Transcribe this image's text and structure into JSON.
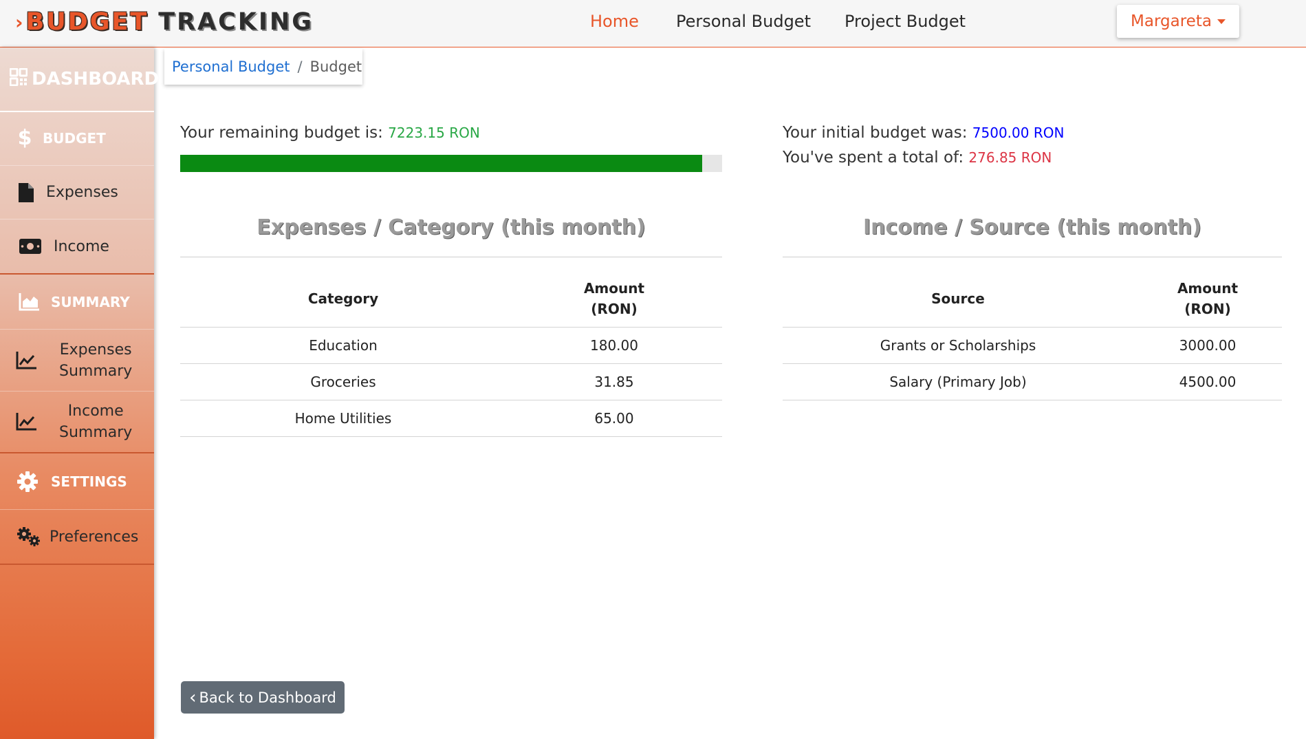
{
  "brand": {
    "chevron": "›",
    "word1": "BUDGET",
    "word2": "TRACKING"
  },
  "nav": {
    "home": "Home",
    "personal_budget": "Personal Budget",
    "project_budget": "Project Budget",
    "user": "Margareta"
  },
  "sidebar": {
    "dashboard": "DASHBOARD",
    "budget_section": "BUDGET",
    "expenses": "Expenses",
    "income": "Income",
    "summary_section": "SUMMARY",
    "expenses_summary_l1": "Expenses",
    "expenses_summary_l2": "Summary",
    "income_summary_l1": "Income",
    "income_summary_l2": "Summary",
    "settings_section": "SETTINGS",
    "preferences": "Preferences",
    "icons": [
      "dashboard-icon",
      "dollar-icon",
      "file-icon",
      "money-bill-icon",
      "area-chart-icon",
      "line-chart-icon",
      "line-chart-icon",
      "gear-icon",
      "gears-icon"
    ]
  },
  "breadcrumb": {
    "link": "Personal Budget",
    "separator": "/",
    "current": "Budget"
  },
  "budget": {
    "remaining_label": "Your remaining budget is:",
    "remaining_value": "7223.15 RON",
    "initial_label": "Your initial budget was:",
    "initial_value": "7500.00 RON",
    "spent_label": "You've spent a total of:",
    "spent_value": "276.85 RON",
    "remaining_fraction": 0.9631,
    "colors": {
      "remaining": "#28a745",
      "initial": "#0000ff",
      "spent": "#dc3545",
      "bar": "#0a8a12"
    }
  },
  "expenses_table": {
    "title": "Expenses / Category (this month)",
    "col1": "Category",
    "col2_l1": "Amount",
    "col2_l2": "(RON)",
    "rows": [
      {
        "category": "Education",
        "amount": "180.00"
      },
      {
        "category": "Groceries",
        "amount": "31.85"
      },
      {
        "category": "Home Utilities",
        "amount": "65.00"
      }
    ]
  },
  "income_table": {
    "title": "Income / Source (this month)",
    "col1": "Source",
    "col2_l1": "Amount",
    "col2_l2": "(RON)",
    "rows": [
      {
        "source": "Grants or Scholarships",
        "amount": "3000.00"
      },
      {
        "source": "Salary (Primary Job)",
        "amount": "4500.00"
      }
    ]
  },
  "back_button": {
    "label": "Back to Dashboard",
    "chevron": "‹"
  },
  "accent": "#e8562a"
}
